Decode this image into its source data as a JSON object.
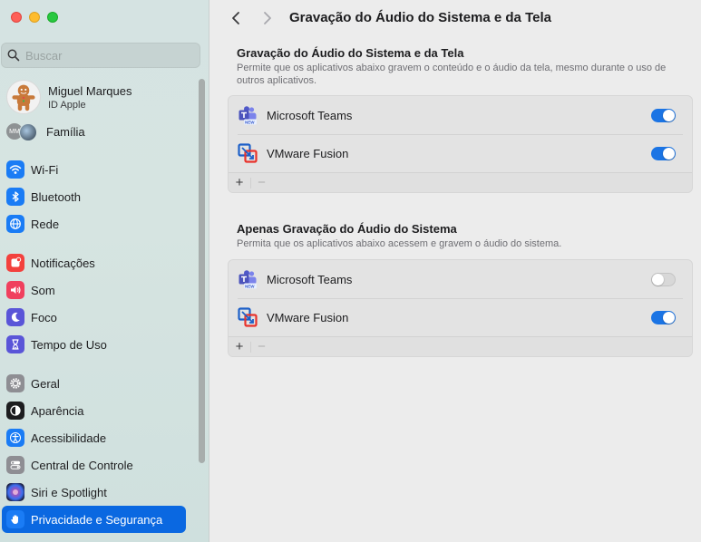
{
  "window": {
    "title": "Gravação do Áudio do Sistema e da Tela"
  },
  "search": {
    "placeholder": "Buscar"
  },
  "profile": {
    "name": "Miguel Marques",
    "subtitle": "ID Apple"
  },
  "family": {
    "label": "Família",
    "initials": "MM"
  },
  "sidebar": {
    "items": [
      {
        "label": "Wi-Fi",
        "icon": "wifi-icon",
        "color": "#1a7cf5"
      },
      {
        "label": "Bluetooth",
        "icon": "bluetooth-icon",
        "color": "#1a7cf5"
      },
      {
        "label": "Rede",
        "icon": "globe-icon",
        "color": "#1a7cf5"
      },
      {
        "label": "Notificações",
        "icon": "bell-icon",
        "color": "#f3413d"
      },
      {
        "label": "Som",
        "icon": "speaker-icon",
        "color": "#f0405e"
      },
      {
        "label": "Foco",
        "icon": "moon-icon",
        "color": "#5a55d8"
      },
      {
        "label": "Tempo de Uso",
        "icon": "hourglass-icon",
        "color": "#5a55d8"
      },
      {
        "label": "Geral",
        "icon": "gear-icon",
        "color": "#8e8e93"
      },
      {
        "label": "Aparência",
        "icon": "appearance-icon",
        "color": "#1d1d1f"
      },
      {
        "label": "Acessibilidade",
        "icon": "accessibility-icon",
        "color": "#1a7cf5"
      },
      {
        "label": "Central de Controle",
        "icon": "control-center-icon",
        "color": "#8e8e93"
      },
      {
        "label": "Siri e Spotlight",
        "icon": "siri-icon",
        "color": "#2b2b5e"
      },
      {
        "label": "Privacidade e Segurança",
        "icon": "hand-icon",
        "color": "#1a7cf5",
        "active": true
      }
    ]
  },
  "sections": [
    {
      "title": "Gravação do Áudio do Sistema e da Tela",
      "description": "Permite que os aplicativos abaixo gravem o conteúdo e o áudio da tela, mesmo durante o uso de outros aplicativos.",
      "apps": [
        {
          "name": "Microsoft Teams",
          "icon": "teams-icon",
          "enabled": true
        },
        {
          "name": "VMware Fusion",
          "icon": "vmware-icon",
          "enabled": true
        }
      ],
      "add_label": "+",
      "remove_label": "−"
    },
    {
      "title": "Apenas Gravação do Áudio do Sistema",
      "description": "Permita que os aplicativos abaixo acessem e gravem o áudio do sistema.",
      "apps": [
        {
          "name": "Microsoft Teams",
          "icon": "teams-icon",
          "enabled": false
        },
        {
          "name": "VMware Fusion",
          "icon": "vmware-icon",
          "enabled": true
        }
      ],
      "add_label": "+",
      "remove_label": "−"
    }
  ],
  "colors": {
    "accent": "#0a68e1",
    "toggle_on": "#1b74e4"
  }
}
